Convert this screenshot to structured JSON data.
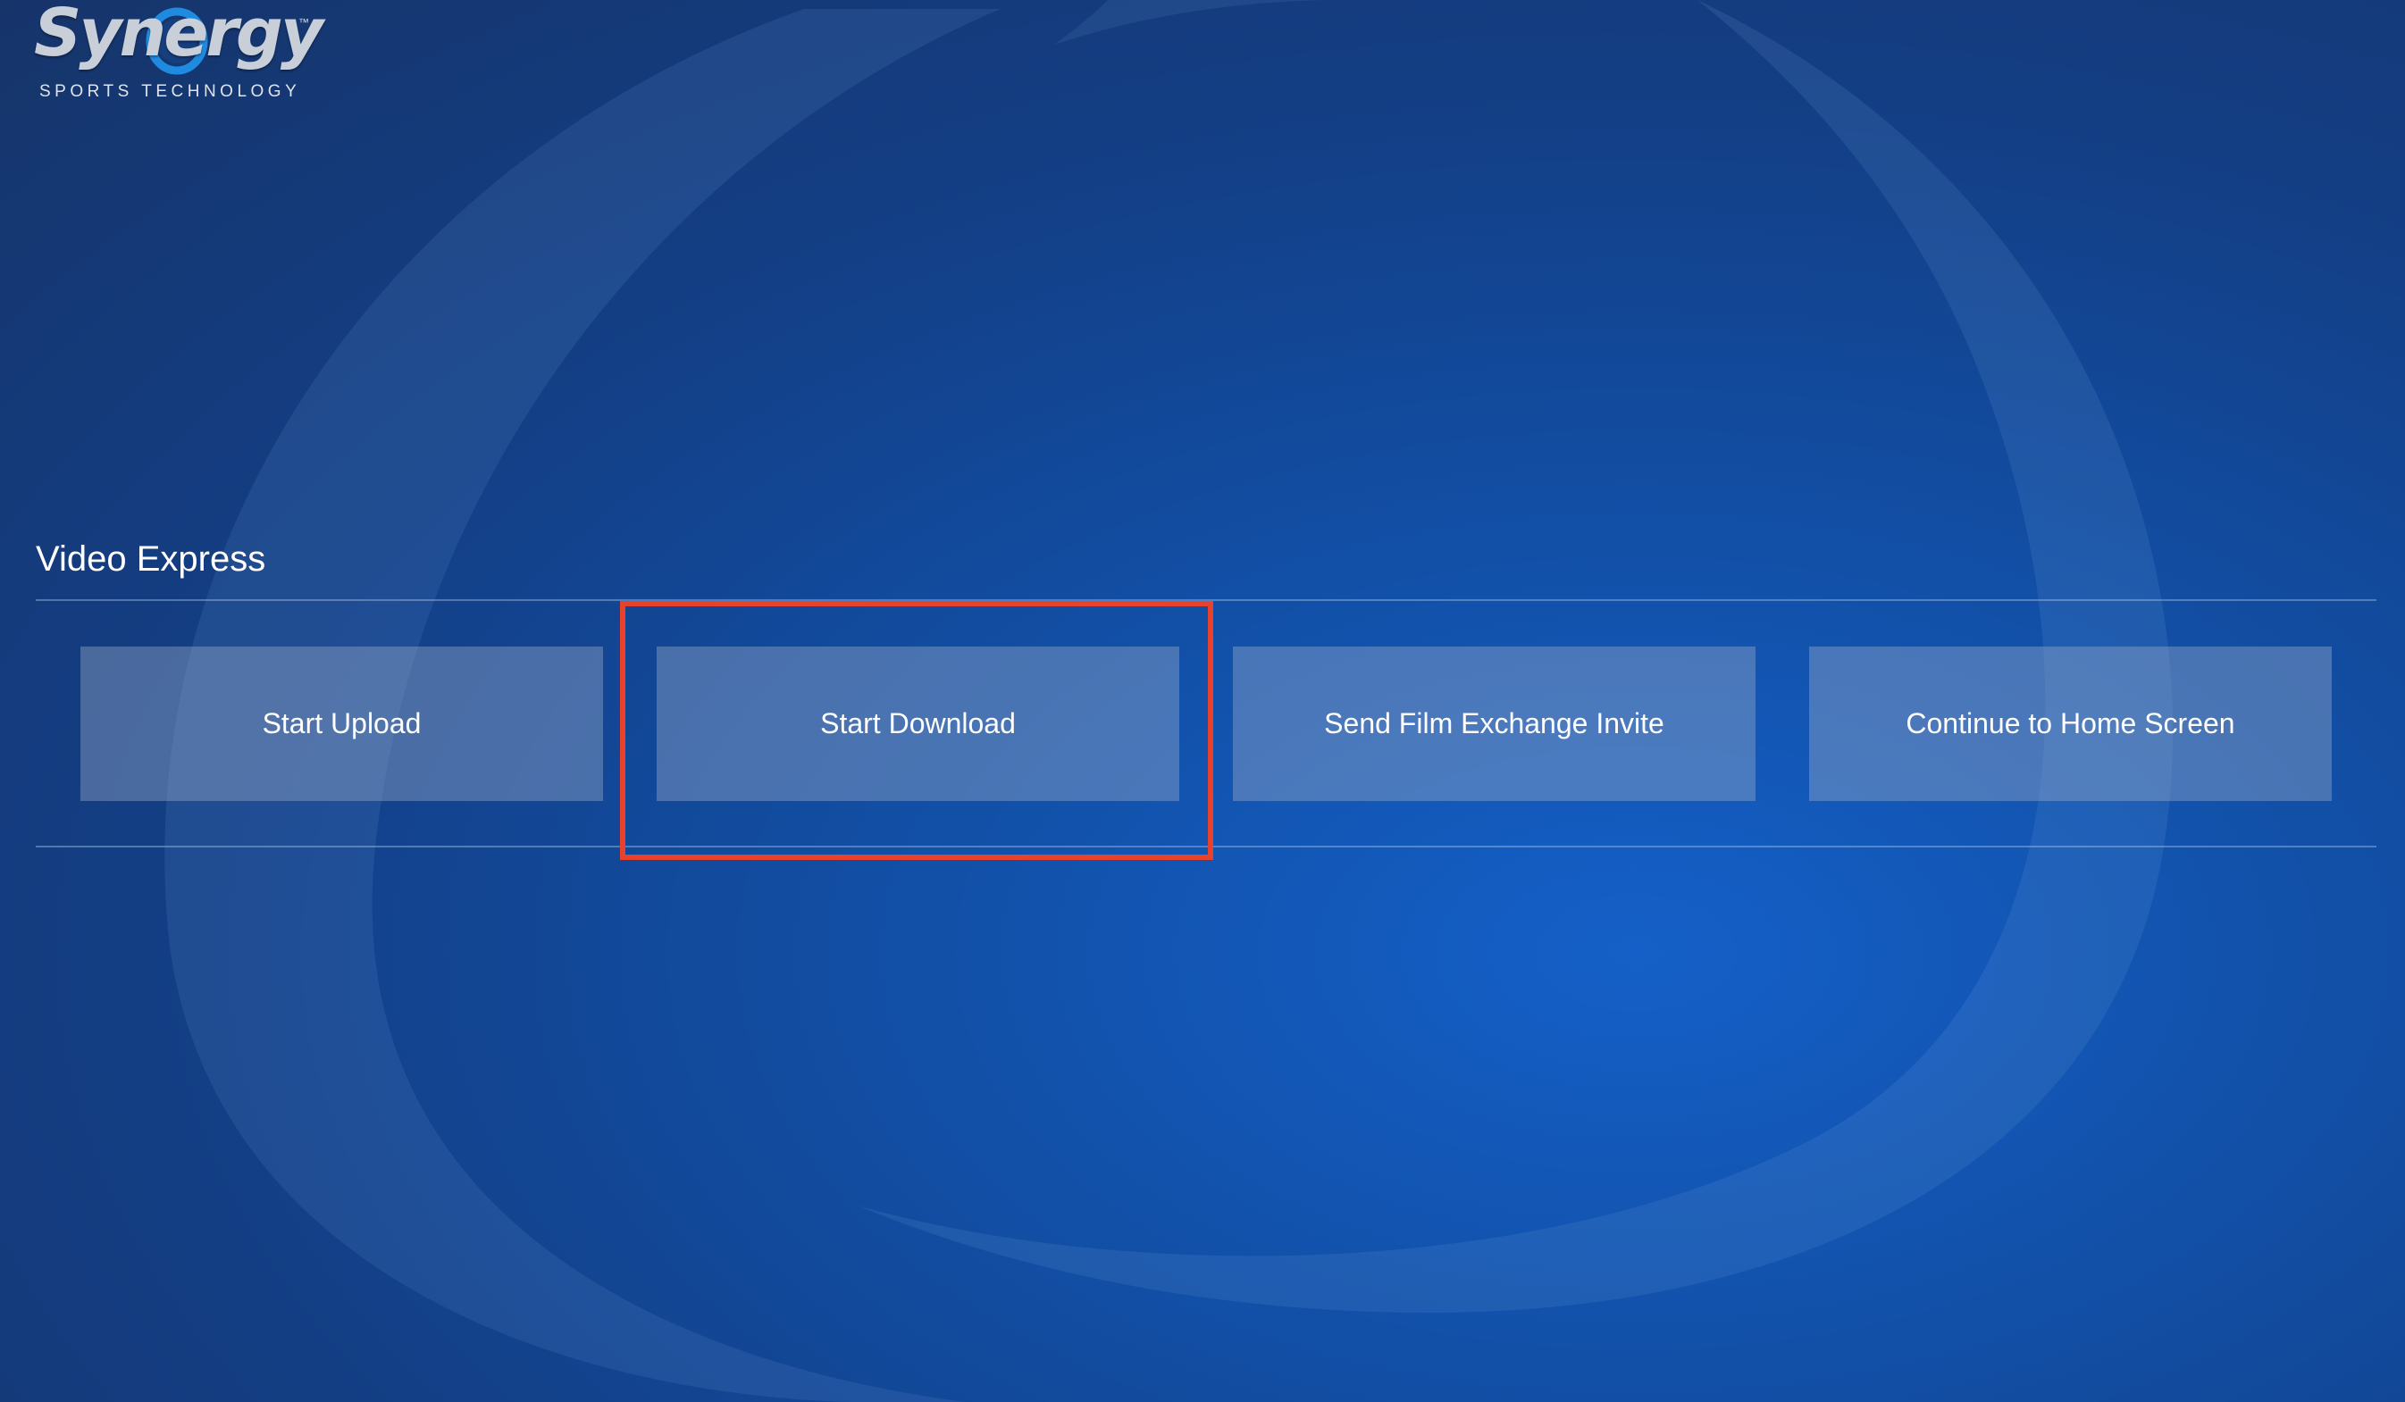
{
  "logo": {
    "wordmark": "Synergy",
    "trademark": "™",
    "tagline": "SPORTS TECHNOLOGY"
  },
  "page": {
    "title": "Video Express"
  },
  "actions": [
    {
      "label": "Start Upload"
    },
    {
      "label": "Start Download"
    },
    {
      "label": "Send Film Exchange Invite"
    },
    {
      "label": "Continue to Home Screen"
    }
  ],
  "highlight": {
    "target": "Start Download",
    "color": "#e8412c"
  },
  "colors": {
    "background": "#1250a8",
    "button_fill": "rgba(150,170,200,0.42)",
    "text": "#ffffff"
  },
  "icons": [
    "synergy-logo-icon"
  ]
}
